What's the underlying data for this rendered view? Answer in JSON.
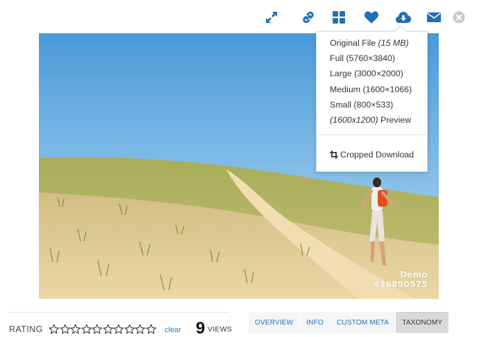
{
  "toolbar": {
    "icons": [
      "expand-icon",
      "link-icon",
      "grid-icon",
      "heart-icon",
      "cloud-download-icon",
      "mail-icon",
      "close-icon"
    ],
    "accent": "#1f6fb3",
    "close_color": "#c9c9c9"
  },
  "download_menu": {
    "original_prefix": "Original File ",
    "original_size": "(15 MB)",
    "full": "Full (5760×3840)",
    "large": "Large (3000×2000)",
    "medium": "Medium (1600×1066)",
    "small": "Small (800×533)",
    "preview_dims": "(1600x1200)",
    "preview_suffix": " Preview",
    "cropped": "Cropped Download"
  },
  "photo": {
    "watermark_line1": "Demo",
    "watermark_line2": "#16890575"
  },
  "rating": {
    "label": "RATING",
    "stars_total": 10,
    "clear": "clear"
  },
  "views": {
    "count": "9",
    "label": "VIEWS"
  },
  "tabs": [
    {
      "label": "OVERVIEW",
      "active": false
    },
    {
      "label": "INFO",
      "active": false
    },
    {
      "label": "CUSTOM META",
      "active": false
    },
    {
      "label": "TAXONOMY",
      "active": true
    }
  ]
}
